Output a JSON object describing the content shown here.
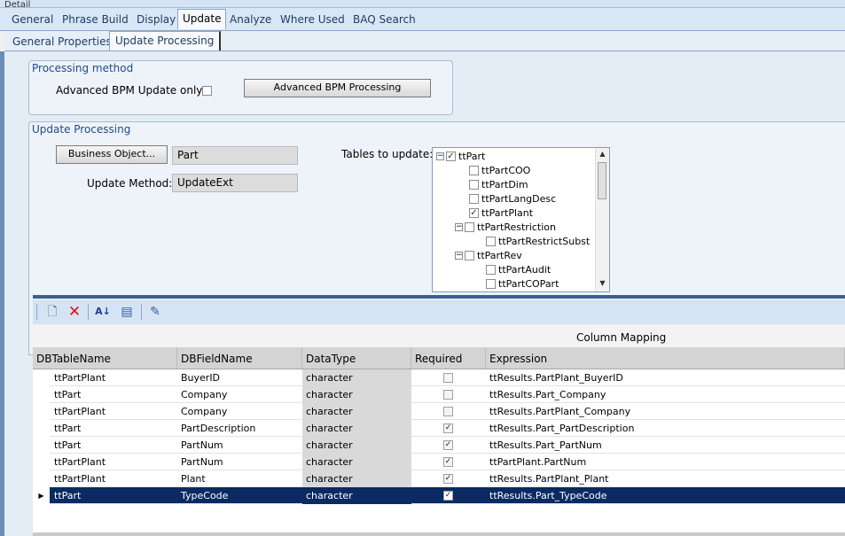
{
  "window": {
    "header_label": "Detail"
  },
  "main_tabs": [
    {
      "label": "General"
    },
    {
      "label": "Phrase Build"
    },
    {
      "label": "Display"
    },
    {
      "label": "Update",
      "active": true
    },
    {
      "label": "Analyze"
    },
    {
      "label": "Where Used"
    },
    {
      "label": "BAQ Search"
    }
  ],
  "sub_tabs": [
    {
      "label": "General Properties"
    },
    {
      "label": "Update  Processing",
      "active": true
    }
  ],
  "processing_method": {
    "title": "Processing method",
    "adv_bpm_only_label": "Advanced BPM Update only:",
    "adv_bpm_only_checked": false,
    "adv_bpm_button": "Advanced BPM Processing"
  },
  "update_processing": {
    "title": "Update Processing",
    "business_object_button": "Business Object...",
    "business_object_value": "Part",
    "update_method_label": "Update Method:",
    "update_method_value": "UpdateExt",
    "tables_label": "Tables to update:",
    "tree": [
      {
        "label": "ttPart",
        "checked": true,
        "expander": "⊟",
        "level": 0
      },
      {
        "label": "ttPartCOO",
        "checked": false,
        "level": 1
      },
      {
        "label": "ttPartDim",
        "checked": false,
        "level": 1
      },
      {
        "label": "ttPartLangDesc",
        "checked": false,
        "level": 1
      },
      {
        "label": "ttPartPlant",
        "checked": true,
        "level": 1
      },
      {
        "label": "ttPartRestriction",
        "checked": false,
        "expander": "⊟",
        "level": 1
      },
      {
        "label": "ttPartRestrictSubst",
        "checked": false,
        "level": 2
      },
      {
        "label": "ttPartRev",
        "checked": false,
        "expander": "⊟",
        "level": 1
      },
      {
        "label": "ttPartAudit",
        "checked": false,
        "level": 2
      },
      {
        "label": "ttPartCOPart",
        "checked": false,
        "level": 2
      }
    ]
  },
  "toolbar": {
    "icons": [
      "new-icon",
      "delete-icon",
      "sort-icon",
      "properties-icon",
      "edit-icon"
    ]
  },
  "grid": {
    "group_header": "Column Mapping",
    "columns": [
      "DBTableName",
      "DBFieldName",
      "DataType",
      "Required",
      "Expression"
    ],
    "rows": [
      {
        "table": "ttPartPlant",
        "field": "BuyerID",
        "type": "character",
        "required": false,
        "expr": "ttResults.PartPlant_BuyerID"
      },
      {
        "table": "ttPart",
        "field": "Company",
        "type": "character",
        "required": false,
        "expr": "ttResults.Part_Company"
      },
      {
        "table": "ttPartPlant",
        "field": "Company",
        "type": "character",
        "required": false,
        "expr": "ttResults.PartPlant_Company"
      },
      {
        "table": "ttPart",
        "field": "PartDescription",
        "type": "character",
        "required": true,
        "expr": "ttResults.Part_PartDescription"
      },
      {
        "table": "ttPart",
        "field": "PartNum",
        "type": "character",
        "required": true,
        "expr": "ttResults.Part_PartNum"
      },
      {
        "table": "ttPartPlant",
        "field": "PartNum",
        "type": "character",
        "required": true,
        "expr": "ttPartPlant.PartNum"
      },
      {
        "table": "ttPartPlant",
        "field": "Plant",
        "type": "character",
        "required": true,
        "expr": "ttResults.PartPlant_Plant"
      },
      {
        "table": "ttPart",
        "field": "TypeCode",
        "type": "character",
        "required": true,
        "expr": "ttResults.Part_TypeCode",
        "selected": true
      }
    ]
  }
}
